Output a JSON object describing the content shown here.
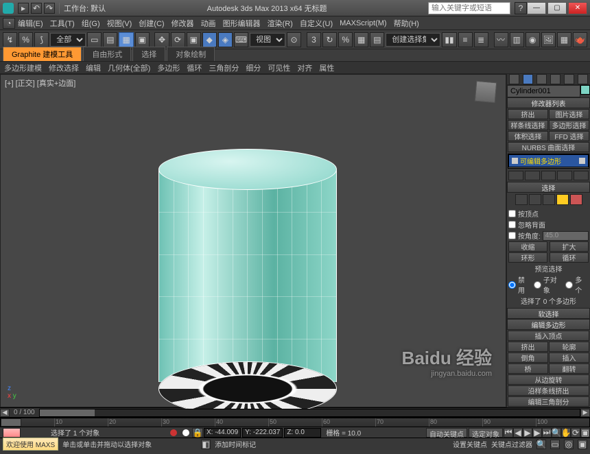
{
  "titlebar": {
    "workspace_label": "工作台: 默认",
    "app_title": "Autodesk 3ds Max 2013 x64   无标题",
    "search_placeholder": "输入关键字或短语"
  },
  "menus": [
    "编辑(E)",
    "工具(T)",
    "组(G)",
    "视图(V)",
    "创建(C)",
    "修改器",
    "动画",
    "图形编辑器",
    "渲染(R)",
    "自定义(U)",
    "MAXScript(M)",
    "帮助(H)"
  ],
  "toolbar": {
    "selset": "全部",
    "view": "视图",
    "dropdown": "创建选择集"
  },
  "ribbon": {
    "tabs": [
      "Graphite 建模工具",
      "自由形式",
      "选择",
      "对象绘制"
    ],
    "sub": [
      "多边形建模",
      "修改选择",
      "编辑",
      "几何体(全部)",
      "多边形",
      "循环",
      "三角剖分",
      "细分",
      "可见性",
      "对齐",
      "属性"
    ]
  },
  "viewport": {
    "label": "[+] [正交] [真实+边面]"
  },
  "panel": {
    "object_name": "Cylinder001",
    "modlist": "修改器列表",
    "buttons_a": [
      "挤出",
      "图片选择",
      "样条线选择",
      "多边形选择",
      "体积选择",
      "FFD 选择"
    ],
    "nurbs": "NURBS 曲面选择",
    "stack_item": "可编辑多边形",
    "sel_header": "选择",
    "by_vertex": "按顶点",
    "ignore_back": "忽略背面",
    "by_angle": "按角度:",
    "angle_val": "45.0",
    "shrink": "收缩",
    "grow": "扩大",
    "ring": "环形",
    "loop": "循环",
    "preview_label": "预览选择",
    "preview_opts": [
      "禁用",
      "子对象",
      "多个"
    ],
    "sel_info": "选择了 0 个多边形",
    "soft_header": "软选择",
    "edit_poly_header": "编辑多边形",
    "insert_vertex": "插入顶点",
    "ep_rows": [
      [
        "挤出",
        "轮廓"
      ],
      [
        "倒角",
        "插入"
      ],
      [
        "桥",
        "翻转"
      ]
    ],
    "from_edge": "从边旋转",
    "edit_extrude": "沿样条线挤出",
    "edit_tri": "编辑三角剖分"
  },
  "timeline": {
    "frame_label": "0 / 100",
    "ticks": [
      "0",
      "10",
      "20",
      "30",
      "40",
      "50",
      "60",
      "70",
      "80",
      "90",
      "100"
    ]
  },
  "status": {
    "sel_text": "选择了 1 个对象",
    "x": "X: -44.009",
    "y": "Y: -222.037",
    "z": "Z: 0.0",
    "grid_label": "栅格 = 10.0",
    "autokey": "自动关键点",
    "selkey": "选定对象",
    "add_time": "添加时间标记",
    "setkey": "设置关键点",
    "keyfilter": "关键点过滤器",
    "welcome": "欢迎使用 MAXS",
    "hint": "单击或单击并拖动以选择对象"
  },
  "watermark": {
    "brand": "Baidu 经验",
    "url": "jingyan.baidu.com"
  }
}
